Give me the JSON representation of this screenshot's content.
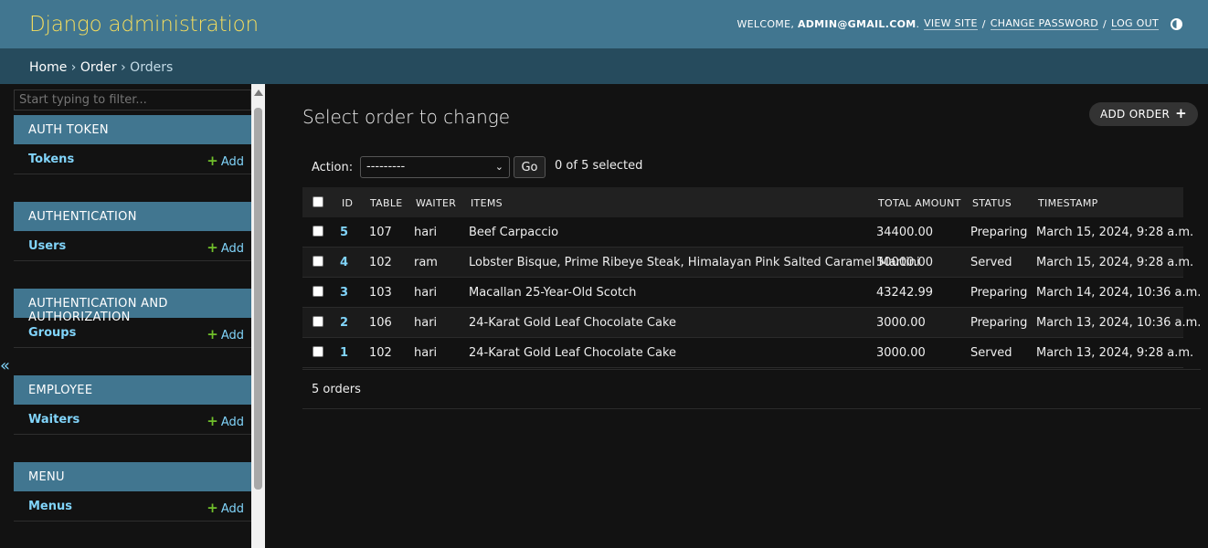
{
  "header": {
    "branding": "Django administration",
    "welcome": "WELCOME,",
    "user": "ADMIN@GMAIL.COM",
    "view_site": "VIEW SITE",
    "change_password": "CHANGE PASSWORD",
    "log_out": "LOG OUT",
    "theme_icon": "half-circle-icon"
  },
  "breadcrumbs": {
    "home": "Home",
    "app": "Order",
    "current": "Orders",
    "separator": "›"
  },
  "sidebar": {
    "filter_placeholder": "Start typing to filter...",
    "add_label": "Add",
    "collapse_glyph": "«",
    "modules": [
      {
        "caption": "AUTH TOKEN",
        "model": "Tokens"
      },
      {
        "caption": "AUTHENTICATION",
        "model": "Users"
      },
      {
        "caption": "AUTHENTICATION AND AUTHORIZATION",
        "model": "Groups"
      },
      {
        "caption": "EMPLOYEE",
        "model": "Waiters"
      },
      {
        "caption": "MENU",
        "model": "Menus"
      }
    ]
  },
  "content": {
    "title": "Select order to change",
    "add_button": "ADD ORDER"
  },
  "actions": {
    "label": "Action:",
    "selected_option": "---------",
    "go": "Go",
    "counter": "0 of 5 selected"
  },
  "table": {
    "headers": {
      "id": "ID",
      "table": "TABLE",
      "waiter": "WAITER",
      "items": "ITEMS",
      "total": "TOTAL AMOUNT",
      "status": "STATUS",
      "timestamp": "TIMESTAMP"
    },
    "rows": [
      {
        "id": "5",
        "table": "107",
        "waiter": "hari",
        "items": "Beef Carpaccio",
        "total": "34400.00",
        "status": "Preparing",
        "timestamp": "March 15, 2024, 9:28 a.m."
      },
      {
        "id": "4",
        "table": "102",
        "waiter": "ram",
        "items": "Lobster Bisque, Prime Ribeye Steak, Himalayan Pink Salted Caramel Martini",
        "total": "50000.00",
        "status": "Served",
        "timestamp": "March 15, 2024, 9:28 a.m."
      },
      {
        "id": "3",
        "table": "103",
        "waiter": "hari",
        "items": "Macallan 25-Year-Old Scotch",
        "total": "43242.99",
        "status": "Preparing",
        "timestamp": "March 14, 2024, 10:36 a.m."
      },
      {
        "id": "2",
        "table": "106",
        "waiter": "hari",
        "items": "24-Karat Gold Leaf Chocolate Cake",
        "total": "3000.00",
        "status": "Preparing",
        "timestamp": "March 13, 2024, 10:36 a.m."
      },
      {
        "id": "1",
        "table": "102",
        "waiter": "hari",
        "items": "24-Karat Gold Leaf Chocolate Cake",
        "total": "3000.00",
        "status": "Served",
        "timestamp": "March 13, 2024, 9:28 a.m."
      }
    ]
  },
  "paginator": {
    "text": "5 orders"
  },
  "colors": {
    "header_bg": "#417690",
    "breadcrumb_bg": "#264b5d",
    "branding": "#f5dd5d",
    "link": "#81d4fa",
    "add_plus": "#70bf2b",
    "body_bg": "#121212"
  }
}
